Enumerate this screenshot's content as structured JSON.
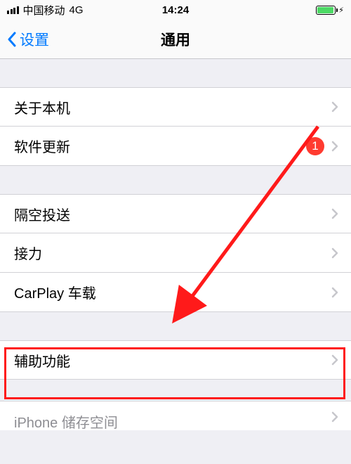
{
  "status": {
    "carrier": "中国移动",
    "network": "4G",
    "time": "14:24"
  },
  "nav": {
    "back_label": "设置",
    "title": "通用"
  },
  "group1": [
    {
      "label": "关于本机",
      "badge": null
    },
    {
      "label": "软件更新",
      "badge": "1"
    }
  ],
  "group2": [
    {
      "label": "隔空投送"
    },
    {
      "label": "接力"
    },
    {
      "label": "CarPlay 车载"
    }
  ],
  "group3": [
    {
      "label": "辅助功能"
    }
  ],
  "group4": [
    {
      "label": "iPhone 储存空间"
    }
  ],
  "annotation": {
    "highlight_color": "#ff1a1a",
    "arrow_color": "#ff1a1a"
  }
}
